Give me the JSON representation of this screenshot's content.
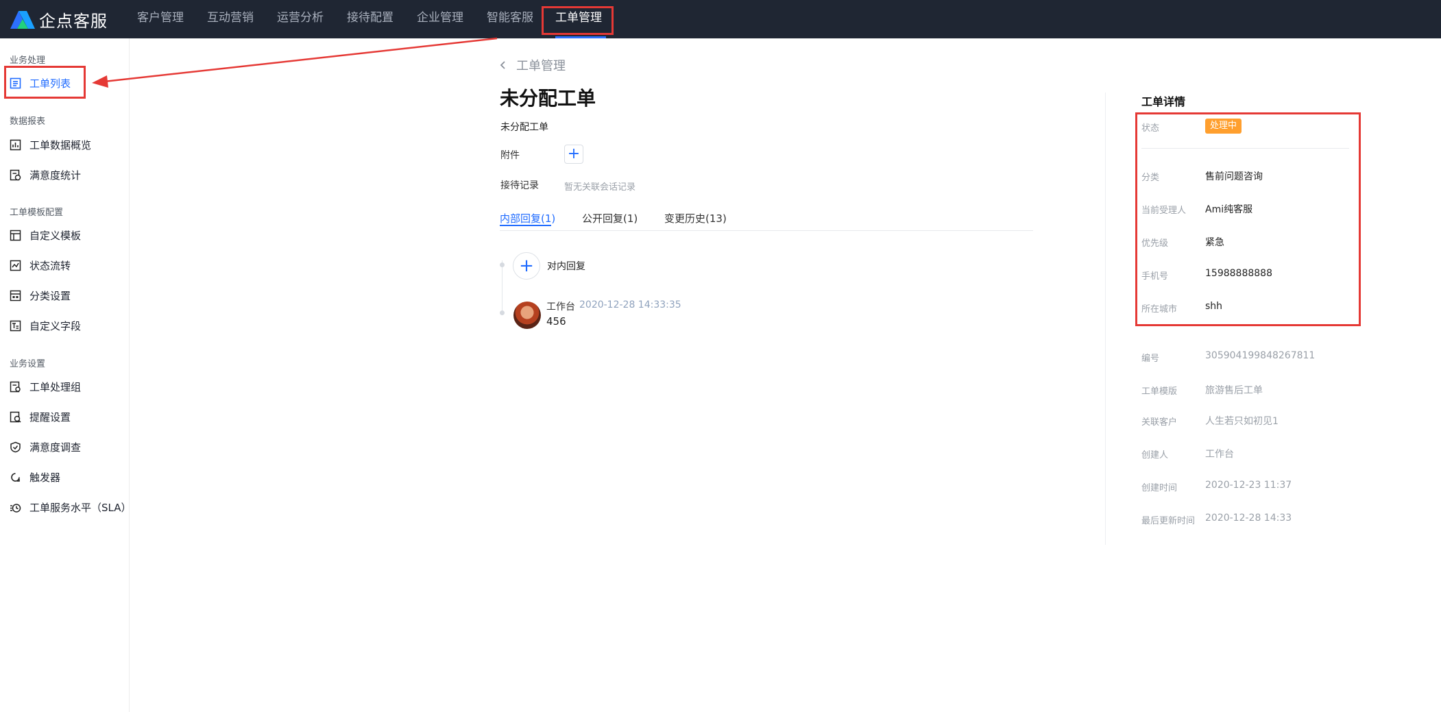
{
  "app": {
    "logo_text": "企点客服",
    "brand_colors": {
      "topbar": "#1f2633",
      "accent": "#1f6bff",
      "highlight": "#e53935",
      "status": "#ff9f2e"
    }
  },
  "topnav": {
    "items": [
      {
        "label": "客户管理",
        "active": false
      },
      {
        "label": "互动营销",
        "active": false
      },
      {
        "label": "运营分析",
        "active": false
      },
      {
        "label": "接待配置",
        "active": false
      },
      {
        "label": "企业管理",
        "active": false
      },
      {
        "label": "智能客服",
        "active": false
      },
      {
        "label": "工单管理",
        "active": true
      }
    ]
  },
  "sidebar": {
    "groups": [
      {
        "title": "业务处理",
        "items": [
          {
            "label": "工单列表",
            "icon": "list-doc-icon",
            "active": true
          }
        ]
      },
      {
        "title": "数据报表",
        "items": [
          {
            "label": "工单数据概览",
            "icon": "bar-chart-icon"
          },
          {
            "label": "满意度统计",
            "icon": "satisfaction-stats-icon"
          }
        ]
      },
      {
        "title": "工单模板配置",
        "items": [
          {
            "label": "自定义模板",
            "icon": "template-icon"
          },
          {
            "label": "状态流转",
            "icon": "flow-chart-icon"
          },
          {
            "label": "分类设置",
            "icon": "category-icon"
          },
          {
            "label": "自定义字段",
            "icon": "custom-field-icon"
          }
        ]
      },
      {
        "title": "业务设置",
        "items": [
          {
            "label": "工单处理组",
            "icon": "group-icon"
          },
          {
            "label": "提醒设置",
            "icon": "reminder-icon"
          },
          {
            "label": "满意度调查",
            "icon": "survey-icon"
          },
          {
            "label": "触发器",
            "icon": "trigger-icon"
          },
          {
            "label": "工单服务水平（SLA）",
            "icon": "sla-clock-icon"
          }
        ]
      }
    ]
  },
  "main": {
    "breadcrumb": "工单管理",
    "title": "未分配工单",
    "subtitle": "未分配工单",
    "attachment_label": "附件",
    "reception_label": "接待记录",
    "reception_empty": "暂无关联会话记录",
    "tabs": [
      {
        "label": "内部回复(1)",
        "active": true
      },
      {
        "label": "公开回复(1)",
        "active": false
      },
      {
        "label": "变更历史(13)",
        "active": false
      }
    ],
    "add_reply_label": "对内回复",
    "replies": [
      {
        "author": "工作台",
        "time": "2020-12-28 14:33:35",
        "body": "456"
      }
    ]
  },
  "details": {
    "title": "工单详情",
    "status_label": "状态",
    "status_value": "处理中",
    "fields": [
      {
        "label": "分类",
        "value": "售前问题咨询"
      },
      {
        "label": "当前受理人",
        "value": "Ami纯客服"
      },
      {
        "label": "优先级",
        "value": "紧急"
      },
      {
        "label": "手机号",
        "value": "15988888888"
      },
      {
        "label": "所在城市",
        "value": "shh"
      }
    ],
    "readonly_fields": [
      {
        "label": "编号",
        "value": "305904199848267811"
      },
      {
        "label": "工单模版",
        "value": "旅游售后工单"
      },
      {
        "label": "关联客户",
        "value": "人生若只如初见1"
      },
      {
        "label": "创建人",
        "value": "工作台"
      },
      {
        "label": "创建时间",
        "value": "2020-12-23 11:37"
      },
      {
        "label": "最后更新时间",
        "value": "2020-12-28 14:33"
      }
    ]
  }
}
